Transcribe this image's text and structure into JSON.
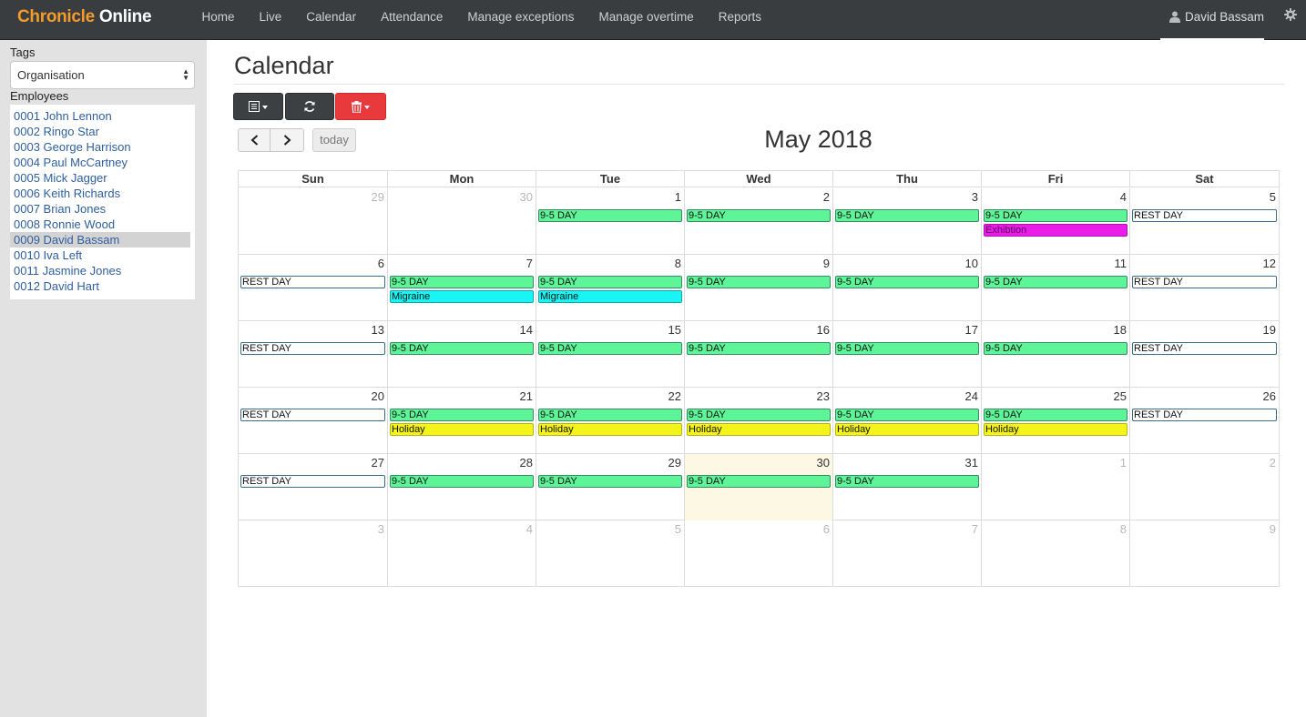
{
  "navbar": {
    "brand_part1": "Chronicle",
    "brand_part2": "Online",
    "links": [
      "Home",
      "Live",
      "Calendar",
      "Attendance",
      "Manage exceptions",
      "Manage overtime",
      "Reports"
    ],
    "user": "David Bassam"
  },
  "sidebar": {
    "tags_label": "Tags",
    "tags_value": "Organisation",
    "employees_label": "Employees",
    "employees": [
      "0001 John Lennon",
      "0002 Ringo Star",
      "0003 George Harrison",
      "0004 Paul McCartney",
      "0005 Mick Jagger",
      "0006 Keith Richards",
      "0007 Brian Jones",
      "0008 Ronnie Wood",
      "0009 David Bassam",
      "0010 Iva Left",
      "0011 Jasmine Jones",
      "0012 David Hart"
    ],
    "selected_index": 8
  },
  "main": {
    "title": "Calendar",
    "today_label": "today",
    "month_title": "May 2018"
  },
  "colors": {
    "work": "#5ef598",
    "rest": "#ffffff",
    "rest_border": "#3b6d8a",
    "exhibition": "#ea1cea",
    "migraine": "#19f4f4",
    "holiday": "#f4f41b"
  },
  "calendar": {
    "weekdays": [
      "Sun",
      "Mon",
      "Tue",
      "Wed",
      "Thu",
      "Fri",
      "Sat"
    ],
    "today": "30",
    "weeks": [
      [
        {
          "num": "29",
          "other": true,
          "events": []
        },
        {
          "num": "30",
          "other": true,
          "events": []
        },
        {
          "num": "1",
          "events": [
            {
              "label": "9-5 DAY",
              "kind": "work"
            }
          ]
        },
        {
          "num": "2",
          "events": [
            {
              "label": "9-5 DAY",
              "kind": "work"
            }
          ]
        },
        {
          "num": "3",
          "events": [
            {
              "label": "9-5 DAY",
              "kind": "work"
            }
          ]
        },
        {
          "num": "4",
          "events": [
            {
              "label": "9-5 DAY",
              "kind": "work"
            },
            {
              "label": "Exhibtion",
              "kind": "exhibition"
            }
          ]
        },
        {
          "num": "5",
          "events": [
            {
              "label": "REST DAY",
              "kind": "rest"
            }
          ]
        }
      ],
      [
        {
          "num": "6",
          "events": [
            {
              "label": "REST DAY",
              "kind": "rest"
            }
          ]
        },
        {
          "num": "7",
          "events": [
            {
              "label": "9-5 DAY",
              "kind": "work"
            },
            {
              "label": "Migraine",
              "kind": "migraine"
            }
          ]
        },
        {
          "num": "8",
          "events": [
            {
              "label": "9-5 DAY",
              "kind": "work"
            },
            {
              "label": "Migraine",
              "kind": "migraine"
            }
          ]
        },
        {
          "num": "9",
          "events": [
            {
              "label": "9-5 DAY",
              "kind": "work"
            }
          ]
        },
        {
          "num": "10",
          "events": [
            {
              "label": "9-5 DAY",
              "kind": "work"
            }
          ]
        },
        {
          "num": "11",
          "events": [
            {
              "label": "9-5 DAY",
              "kind": "work"
            }
          ]
        },
        {
          "num": "12",
          "events": [
            {
              "label": "REST DAY",
              "kind": "rest"
            }
          ]
        }
      ],
      [
        {
          "num": "13",
          "events": [
            {
              "label": "REST DAY",
              "kind": "rest"
            }
          ]
        },
        {
          "num": "14",
          "events": [
            {
              "label": "9-5 DAY",
              "kind": "work"
            }
          ]
        },
        {
          "num": "15",
          "events": [
            {
              "label": "9-5 DAY",
              "kind": "work"
            }
          ]
        },
        {
          "num": "16",
          "events": [
            {
              "label": "9-5 DAY",
              "kind": "work"
            }
          ]
        },
        {
          "num": "17",
          "events": [
            {
              "label": "9-5 DAY",
              "kind": "work"
            }
          ]
        },
        {
          "num": "18",
          "events": [
            {
              "label": "9-5 DAY",
              "kind": "work"
            }
          ]
        },
        {
          "num": "19",
          "events": [
            {
              "label": "REST DAY",
              "kind": "rest"
            }
          ]
        }
      ],
      [
        {
          "num": "20",
          "events": [
            {
              "label": "REST DAY",
              "kind": "rest"
            }
          ]
        },
        {
          "num": "21",
          "events": [
            {
              "label": "9-5 DAY",
              "kind": "work"
            },
            {
              "label": "Holiday",
              "kind": "holiday"
            }
          ]
        },
        {
          "num": "22",
          "events": [
            {
              "label": "9-5 DAY",
              "kind": "work"
            },
            {
              "label": "Holiday",
              "kind": "holiday"
            }
          ]
        },
        {
          "num": "23",
          "events": [
            {
              "label": "9-5 DAY",
              "kind": "work"
            },
            {
              "label": "Holiday",
              "kind": "holiday"
            }
          ]
        },
        {
          "num": "24",
          "events": [
            {
              "label": "9-5 DAY",
              "kind": "work"
            },
            {
              "label": "Holiday",
              "kind": "holiday"
            }
          ]
        },
        {
          "num": "25",
          "events": [
            {
              "label": "9-5 DAY",
              "kind": "work"
            },
            {
              "label": "Holiday",
              "kind": "holiday"
            }
          ]
        },
        {
          "num": "26",
          "events": [
            {
              "label": "REST DAY",
              "kind": "rest"
            }
          ]
        }
      ],
      [
        {
          "num": "27",
          "events": [
            {
              "label": "REST DAY",
              "kind": "rest"
            }
          ]
        },
        {
          "num": "28",
          "events": [
            {
              "label": "9-5 DAY",
              "kind": "work"
            }
          ]
        },
        {
          "num": "29",
          "events": [
            {
              "label": "9-5 DAY",
              "kind": "work"
            }
          ]
        },
        {
          "num": "30",
          "events": [
            {
              "label": "9-5 DAY",
              "kind": "work"
            }
          ]
        },
        {
          "num": "31",
          "events": [
            {
              "label": "9-5 DAY",
              "kind": "work"
            }
          ]
        },
        {
          "num": "1",
          "other": true,
          "events": []
        },
        {
          "num": "2",
          "other": true,
          "events": []
        }
      ],
      [
        {
          "num": "3",
          "other": true,
          "events": []
        },
        {
          "num": "4",
          "other": true,
          "events": []
        },
        {
          "num": "5",
          "other": true,
          "events": []
        },
        {
          "num": "6",
          "other": true,
          "events": []
        },
        {
          "num": "7",
          "other": true,
          "events": []
        },
        {
          "num": "8",
          "other": true,
          "events": []
        },
        {
          "num": "9",
          "other": true,
          "events": []
        }
      ]
    ]
  }
}
